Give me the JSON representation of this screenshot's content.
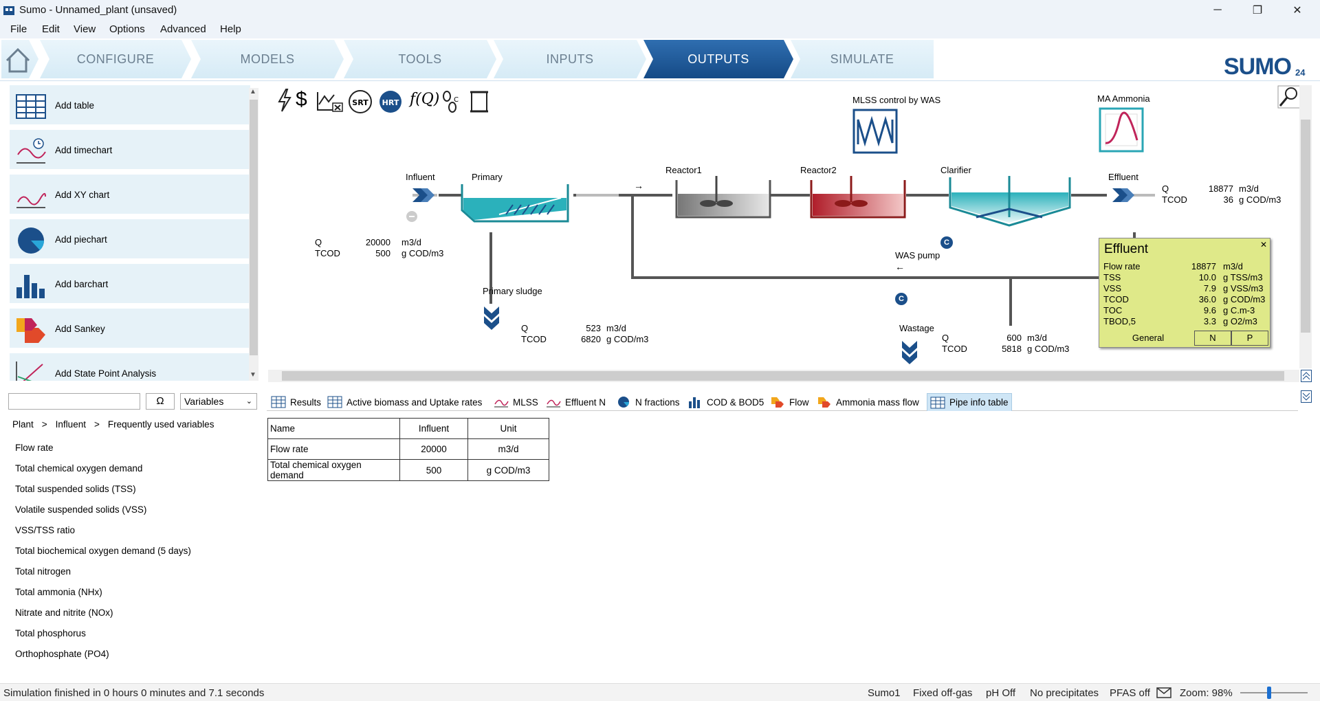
{
  "window": {
    "title": "Sumo - Unnamed_plant (unsaved)",
    "controls": {
      "minimize": "─",
      "restore": "❐",
      "close": "✕"
    }
  },
  "menu": [
    "File",
    "Edit",
    "View",
    "Options",
    "Advanced",
    "Help"
  ],
  "ribbon": {
    "tabs": [
      "CONFIGURE",
      "MODELS",
      "TOOLS",
      "INPUTS",
      "OUTPUTS",
      "SIMULATE"
    ],
    "active": "OUTPUTS",
    "logo": "SUMO",
    "logo_version": "24"
  },
  "left_panel": {
    "items": [
      "Add table",
      "Add timechart",
      "Add XY chart",
      "Add piechart",
      "Add barchart",
      "Add Sankey",
      "Add State Point Analysis"
    ]
  },
  "variables_panel": {
    "search_value": "",
    "omega_label": "Ω",
    "type_select": "Variables",
    "breadcrumb": [
      "Plant",
      ">",
      "Influent",
      ">",
      "Frequently used variables"
    ],
    "items": [
      "Flow rate",
      "Total chemical oxygen demand",
      "Total suspended solids (TSS)",
      "Volatile suspended solids (VSS)",
      "VSS/TSS ratio",
      "Total biochemical oxygen demand (5 days)",
      "Total nitrogen",
      "Total ammonia (NHx)",
      "Nitrate and nitrite (NOx)",
      "Total phosphorus",
      "Orthophosphate (PO4)"
    ]
  },
  "toolbar_icons": [
    "lightning-icon",
    "dollar-icon",
    "chart-delete-icon",
    "srt-icon",
    "hrt-icon",
    "function-icon",
    "footprint-icon",
    "scroll-icon"
  ],
  "toolbar_text": {
    "srt": "SRT",
    "hrt": "HRT",
    "fq": "f(Q)"
  },
  "diagram": {
    "units": {
      "influent": "Influent",
      "primary": "Primary",
      "reactor1": "Reactor1",
      "reactor2": "Reactor2",
      "clarifier": "Clarifier",
      "effluent": "Effluent",
      "primary_sludge": "Primary sludge",
      "was_pump": "WAS pump",
      "wastage": "Wastage"
    },
    "controllers": {
      "mlss": "MLSS control by WAS",
      "ammonia": "MA Ammonia"
    },
    "badge_c": "C",
    "influent_info": {
      "rows": [
        [
          "Q",
          "20000",
          "m3/d"
        ],
        [
          "TCOD",
          "500",
          "g COD/m3"
        ]
      ]
    },
    "primary_sludge_info": {
      "rows": [
        [
          "Q",
          "523",
          "m3/d"
        ],
        [
          "TCOD",
          "6820",
          "g COD/m3"
        ]
      ]
    },
    "wastage_info": {
      "rows": [
        [
          "Q",
          "600",
          "m3/d"
        ],
        [
          "TCOD",
          "5818",
          "g COD/m3"
        ]
      ]
    },
    "effluent_info": {
      "rows": [
        [
          "Q",
          "18877",
          "m3/d"
        ],
        [
          "TCOD",
          "36",
          "g COD/m3"
        ]
      ]
    }
  },
  "effluent_box": {
    "title": "Effluent",
    "close": "✕",
    "rows": [
      [
        "Flow rate",
        "18877",
        "m3/d"
      ],
      [
        "TSS",
        "10.0",
        "g TSS/m3"
      ],
      [
        "VSS",
        "7.9",
        "g VSS/m3"
      ],
      [
        "TCOD",
        "36.0",
        "g COD/m3"
      ],
      [
        "TOC",
        "9.6",
        "g C.m-3"
      ],
      [
        "TBOD,5",
        "3.3",
        "g O2/m3"
      ]
    ],
    "tabs": [
      "General",
      "N",
      "P"
    ]
  },
  "bottom_tabs": [
    "Results",
    "Active biomass and Uptake rates",
    "MLSS",
    "Effluent N",
    "N fractions",
    "COD & BOD5",
    "Flow",
    "Ammonia mass flow",
    "Pipe info table"
  ],
  "bottom_active": "Pipe info table",
  "pipe_table": {
    "headers": [
      "Name",
      "Influent",
      "Unit"
    ],
    "rows": [
      [
        "Flow rate",
        "20000",
        "m3/d"
      ],
      [
        "Total chemical oxygen demand",
        "500",
        "g COD/m3"
      ]
    ]
  },
  "status": {
    "message": "Simulation finished in 0 hours 0 minutes and 7.1 seconds",
    "model": "Sumo1",
    "offgas": "Fixed off-gas",
    "ph": "pH Off",
    "precip": "No precipitates",
    "pfas": "PFAS off",
    "zoom": "Zoom: 98%"
  }
}
